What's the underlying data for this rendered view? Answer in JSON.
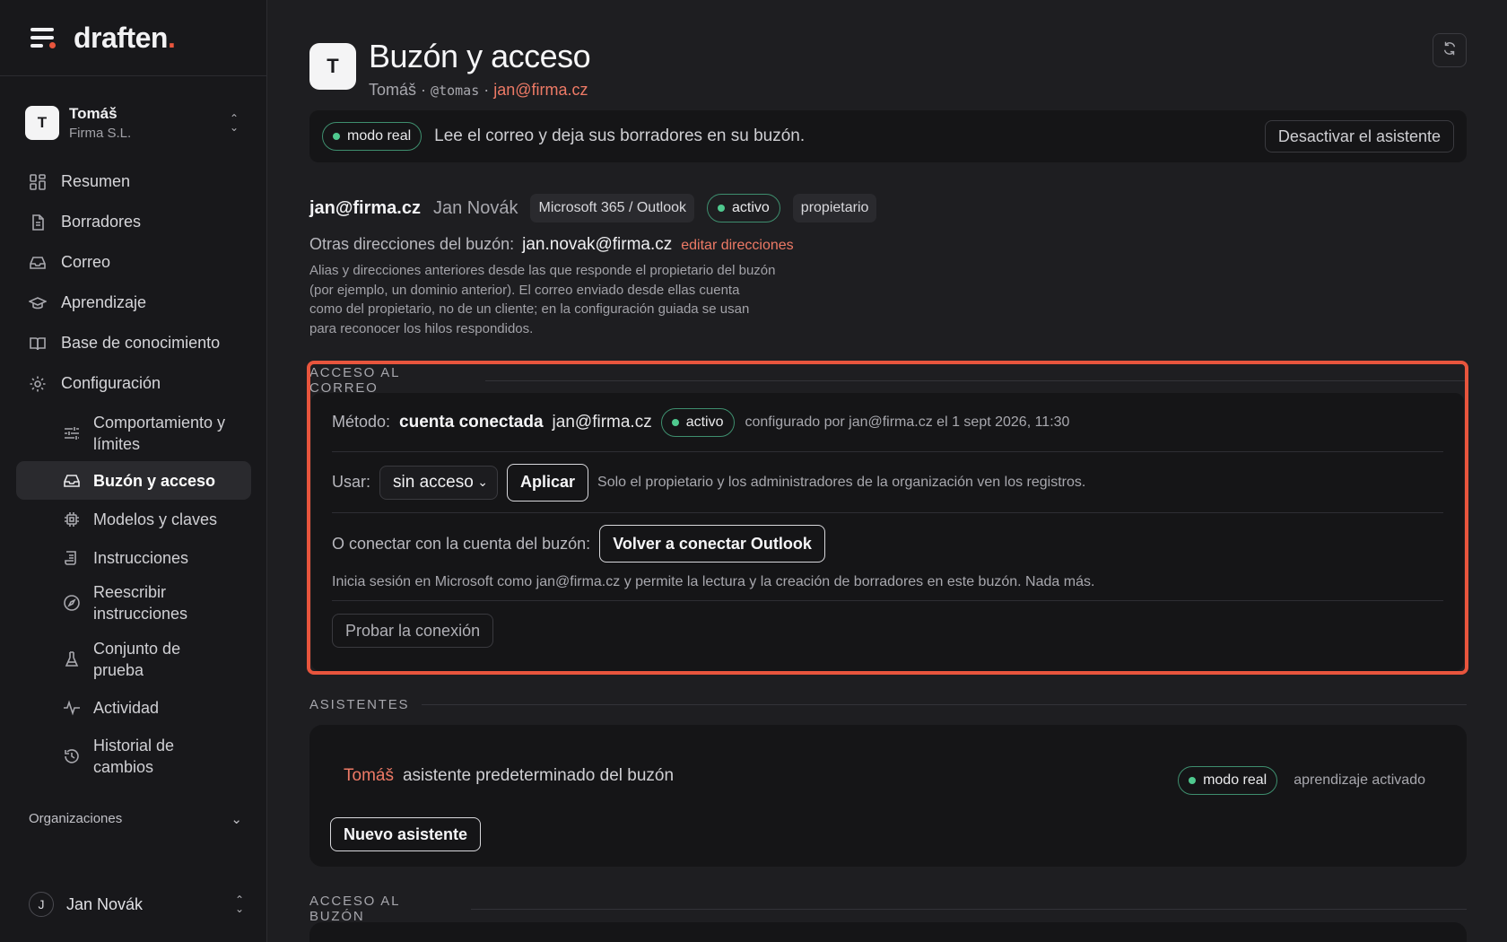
{
  "brand": {
    "name": "draften",
    "dot": "."
  },
  "org": {
    "avatar": "T",
    "name": "Tomáš",
    "sub": "Firma S.L."
  },
  "nav": {
    "summary": "Resumen",
    "drafts": "Borradores",
    "mail": "Correo",
    "learning": "Aprendizaje",
    "knowledge": "Base de conocimiento",
    "settings": "Configuración",
    "sub": {
      "behavior": "Comportamiento y límites",
      "mailbox": "Buzón y acceso",
      "models": "Modelos y claves",
      "instructions": "Instrucciones",
      "rewrite": "Reescribir instrucciones",
      "testset": "Conjunto de prueba",
      "activity": "Actividad",
      "history": "Historial de cambios"
    },
    "organizations": "Organizaciones"
  },
  "user": {
    "avatar": "J",
    "name": "Jan Novák"
  },
  "header": {
    "avatar": "T",
    "title": "Buzón y acceso",
    "owner": "Tomáš",
    "sep": "·",
    "handle": "@tomas",
    "email": "jan@firma.cz"
  },
  "banner": {
    "mode": "modo real",
    "text": "Lee el correo y deja sus borradores en su buzón.",
    "deactivate": "Desactivar el asistente"
  },
  "account": {
    "email": "jan@firma.cz",
    "name": "Jan Novák",
    "provider": "Microsoft 365 / Outlook",
    "status": "activo",
    "role": "propietario"
  },
  "other_addresses": {
    "label": "Otras direcciones del buzón:",
    "value": "jan.novak@firma.cz",
    "edit": "editar direcciones",
    "help": "Alias y direcciones anteriores desde las que responde el propietario del buzón (por ejemplo, un dominio anterior). El correo enviado desde ellas cuenta como del propietario, no de un cliente; en la configuración guiada se usan para reconocer los hilos respondidos."
  },
  "mail_access": {
    "section": "ACCESO AL CORREO",
    "method_label": "Método:",
    "method_value": "cuenta conectada",
    "method_email": "jan@firma.cz",
    "status": "activo",
    "configured": "configurado por jan@firma.cz el 1 sept 2026, 11:30",
    "use_label": "Usar:",
    "use_selected": "sin acceso",
    "apply": "Aplicar",
    "use_note": "Solo el propietario y los administradores de la organización ven los registros.",
    "connect_label": "O conectar con la cuenta del buzón:",
    "reconnect": "Volver a conectar Outlook",
    "connect_note": "Inicia sesión en Microsoft como jan@firma.cz y permite la lectura y la creación de borradores en este buzón. Nada más.",
    "test": "Probar la conexión"
  },
  "assistants": {
    "section": "ASISTENTES",
    "name": "Tomáš",
    "desc": "asistente predeterminado del buzón",
    "mode": "modo real",
    "learning": "aprendizaje activado",
    "new": "Nuevo asistente"
  },
  "mailbox_access": {
    "section": "ACCESO AL BUZÓN"
  },
  "colors": {
    "accent": "#e8553d",
    "link": "#ee7a66",
    "success": "#4fc98f"
  }
}
